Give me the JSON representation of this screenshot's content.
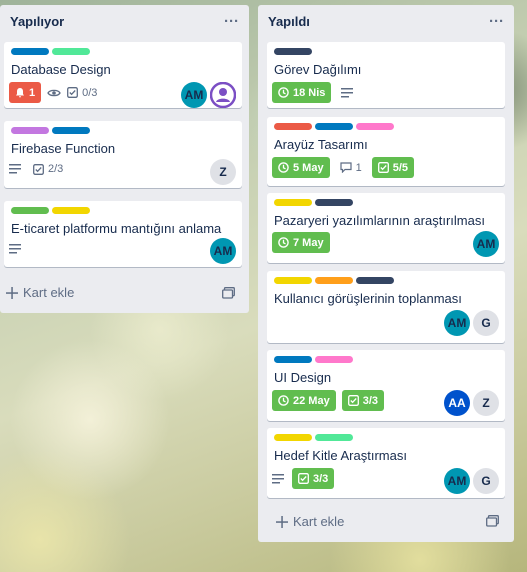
{
  "colors": {
    "label_blue": "#0079bf",
    "label_green_light": "#51e898",
    "label_purple": "#c377e0",
    "label_green": "#61bd4f",
    "label_yellow": "#f2d600",
    "label_navy": "#344563",
    "label_red": "#eb5a46",
    "label_pink": "#ff78cb",
    "label_orange": "#ff9f1a",
    "badge_green": "#61bd4f",
    "badge_red": "#eb5a46"
  },
  "lists": [
    {
      "title": "Yapılıyor",
      "menu": "···",
      "add_card": "Kart ekle",
      "cards": [
        {
          "title": "Database Design",
          "labels": [
            "label_blue",
            "label_green_light"
          ],
          "badges": {
            "notification": "1",
            "checklist": "0/3"
          },
          "members": [
            "AM",
            "avatar-photo"
          ]
        },
        {
          "title": "Firebase Function",
          "labels": [
            "label_purple",
            "label_blue"
          ],
          "badges": {
            "checklist": "2/3"
          },
          "members": [
            "Z"
          ]
        },
        {
          "title": "E-ticaret platformu mantığını anlama",
          "labels": [
            "label_green",
            "label_yellow"
          ],
          "badges": {},
          "members": [
            "AM"
          ]
        }
      ]
    },
    {
      "title": "Yapıldı",
      "menu": "···",
      "add_card": "Kart ekle",
      "cards": [
        {
          "title": "Görev Dağılımı",
          "labels": [
            "label_navy"
          ],
          "badges": {
            "due": "18 Nis"
          },
          "members": []
        },
        {
          "title": "Arayüz Tasarımı",
          "labels": [
            "label_red",
            "label_blue",
            "label_pink"
          ],
          "badges": {
            "due": "5 May",
            "comments": "1",
            "checklist": "5/5"
          },
          "members": []
        },
        {
          "title": "Pazaryeri yazılımlarının araştırılması",
          "labels": [
            "label_yellow",
            "label_navy"
          ],
          "badges": {
            "due": "7 May"
          },
          "members": [
            "AM"
          ]
        },
        {
          "title": "Kullanıcı görüşlerinin toplanması",
          "labels": [
            "label_yellow",
            "label_orange",
            "label_navy"
          ],
          "badges": {},
          "members": [
            "AM",
            "G"
          ]
        },
        {
          "title": "UI Design",
          "labels": [
            "label_blue",
            "label_pink"
          ],
          "badges": {
            "due": "22 May",
            "checklist": "3/3"
          },
          "members": [
            "AA",
            "Z"
          ]
        },
        {
          "title": "Hedef Kitle Araştırması",
          "labels": [
            "label_yellow",
            "label_green_light"
          ],
          "badges": {
            "checklist": "3/3"
          },
          "members": [
            "AM",
            "G"
          ]
        }
      ]
    }
  ]
}
